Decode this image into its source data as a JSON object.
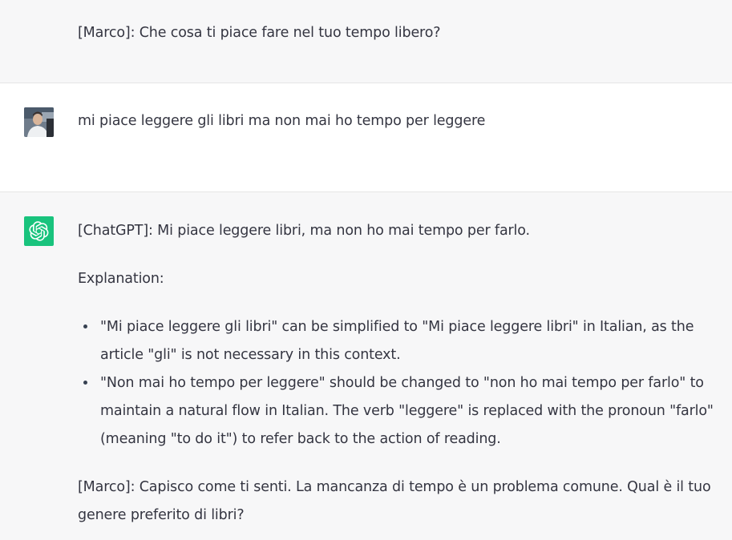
{
  "messages": [
    {
      "role": "assistant",
      "text": "[Marco]: Che cosa ti piace fare nel tuo tempo libero?"
    },
    {
      "role": "user",
      "avatar_icon": "user-photo-avatar",
      "text": "mi piace leggere gli libri ma non mai ho tempo per leggere"
    },
    {
      "role": "assistant",
      "avatar_icon": "openai-logo-icon",
      "avatar_color": "#19c37d",
      "correction": "[ChatGPT]: Mi piace leggere libri, ma non ho mai tempo per farlo.",
      "explanation_heading": "Explanation:",
      "bullets": [
        {
          "line1": "\"Mi piace leggere gli libri\" can be simplified to \"Mi piace leggere libri\" in Italian, as the",
          "line2": "article \"gli\" is not necessary in this context."
        },
        {
          "line1": "\"Non mai ho tempo per leggere\" should be changed to \"non ho mai tempo per farlo\" to",
          "line2": "maintain a natural flow in Italian. The verb \"leggere\" is replaced with the pronoun \"farlo\"",
          "line3": "(meaning \"to do it\") to refer back to the action of reading."
        }
      ],
      "reply_line1": "[Marco]: Capisco come ti senti. La mancanza di tempo è un problema comune. Qual è il tuo",
      "reply_line2": "genere preferito di libri?"
    }
  ]
}
